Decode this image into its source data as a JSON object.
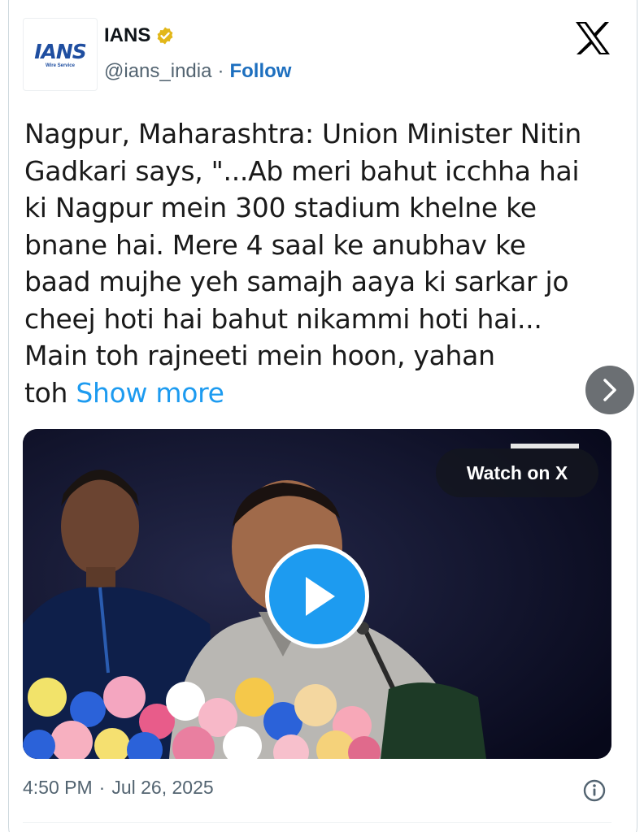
{
  "author": {
    "display_name": "IANS",
    "handle": "@ians_india",
    "follow_label": "Follow",
    "avatar_logo": "IANS",
    "avatar_subtitle": "Wire Service",
    "verified_color": "#e2b719"
  },
  "separator": "·",
  "tweet": {
    "lines": [
      "Nagpur, Maharashtra: Union Minister Nitin",
      "Gadkari says, \"...Ab meri bahut icchha hai",
      "ki Nagpur mein 300 stadium khelne ke",
      "bnane hai. Mere 4 saal ke anubhav ke",
      "baad mujhe yeh samajh aaya ki sarkar jo",
      "cheej hoti hai bahut nikammi hoti hai...",
      "Main toh rajneeti mein hoon, yahan"
    ],
    "last_line_prefix": "toh",
    "show_more_label": "Show more"
  },
  "video": {
    "watch_label": "Watch on X",
    "play_icon": "play-icon"
  },
  "footer": {
    "time": "4:50 PM",
    "date": "Jul 26, 2025"
  },
  "colors": {
    "accent": "#1d9bf0",
    "follow": "#1d6fbf",
    "muted": "#536471"
  }
}
